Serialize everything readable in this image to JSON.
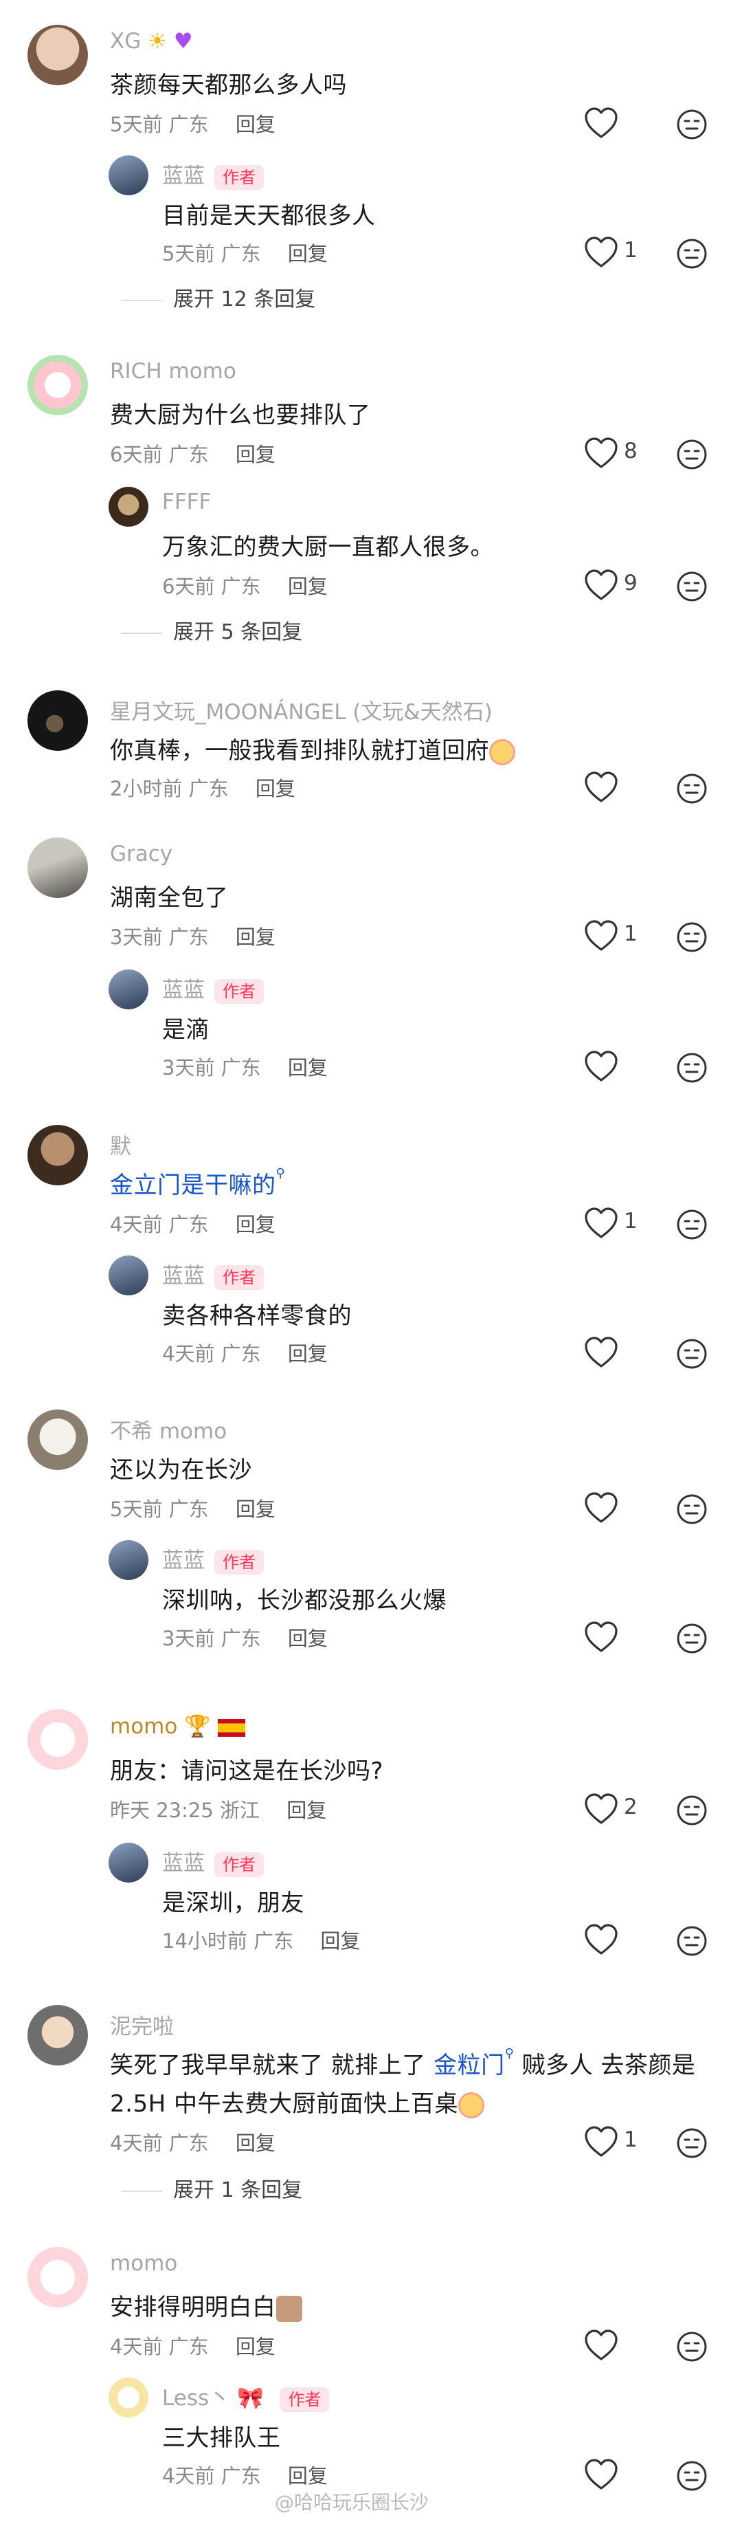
{
  "comments": [
    {
      "user": "XG",
      "text": "茶颜每天都那么多人吗",
      "time": "5天前",
      "loc": "广东",
      "reply": "回复",
      "likes": ""
    },
    {
      "user": "蓝蓝",
      "tag": "作者",
      "text": "目前是天天都很多人",
      "time": "5天前",
      "loc": "广东",
      "reply": "回复",
      "likes": "1"
    },
    {
      "expand": "展开 12 条回复"
    },
    {
      "user": "RICH momo",
      "text": "费大厨为什么也要排队了",
      "time": "6天前",
      "loc": "广东",
      "reply": "回复",
      "likes": "8"
    },
    {
      "user": "FFFF",
      "text": "万象汇的费大厨一直都人很多。",
      "time": "6天前",
      "loc": "广东",
      "reply": "回复",
      "likes": "9"
    },
    {
      "expand": "展开 5 条回复"
    },
    {
      "user": "星月文玩_MOONÁNGEL (文玩&天然石)",
      "text": "你真棒，一般我看到排队就打道回府",
      "time": "2小时前",
      "loc": "广东",
      "reply": "回复",
      "likes": ""
    },
    {
      "user": "Gracy",
      "text": "湖南全包了",
      "time": "3天前",
      "loc": "广东",
      "reply": "回复",
      "likes": "1"
    },
    {
      "user": "蓝蓝",
      "tag": "作者",
      "text": "是滴",
      "time": "3天前",
      "loc": "广东",
      "reply": "回复",
      "likes": ""
    },
    {
      "user": "默",
      "text": "金立门是干嘛的",
      "time": "4天前",
      "loc": "广东",
      "reply": "回复",
      "likes": "1"
    },
    {
      "user": "蓝蓝",
      "tag": "作者",
      "text": "卖各种各样零食的",
      "time": "4天前",
      "loc": "广东",
      "reply": "回复",
      "likes": ""
    },
    {
      "user": "不希 momo",
      "text": "还以为在长沙",
      "time": "5天前",
      "loc": "广东",
      "reply": "回复",
      "likes": ""
    },
    {
      "user": "蓝蓝",
      "tag": "作者",
      "text": "深圳呐，长沙都没那么火爆",
      "time": "3天前",
      "loc": "广东",
      "reply": "回复",
      "likes": ""
    },
    {
      "user": "momo",
      "text": "朋友：请问这是在长沙吗?",
      "time": "昨天 23:25",
      "loc": "浙江",
      "reply": "回复",
      "likes": "2"
    },
    {
      "user": "蓝蓝",
      "tag": "作者",
      "text": "是深圳，朋友",
      "time": "14小时前",
      "loc": "广东",
      "reply": "回复",
      "likes": ""
    },
    {
      "user": "泥完啦",
      "text1a": "笑死了我早早就来了 就排上了 ",
      "link": "金粒门",
      "text1b": " 贼多人 去茶颜是",
      "text2": "2.5H 中午去费大厨前面快上百桌",
      "time": "4天前",
      "loc": "广东",
      "reply": "回复",
      "likes": "1"
    },
    {
      "expand": "展开 1 条回复"
    },
    {
      "user": "momo",
      "text": "安排得明明白白",
      "time": "4天前",
      "loc": "广东",
      "reply": "回复",
      "likes": ""
    },
    {
      "user": "Less丶",
      "tag": "作者",
      "text": "三大排队王",
      "time": "4天前",
      "loc": "广东",
      "reply": "回复",
      "likes": ""
    }
  ],
  "watermark": "@哈哈玩乐圈长沙",
  "colors": {
    "meta": "#8a8a8a",
    "tag": "#ff3b5c",
    "link": "#1a56c9"
  }
}
